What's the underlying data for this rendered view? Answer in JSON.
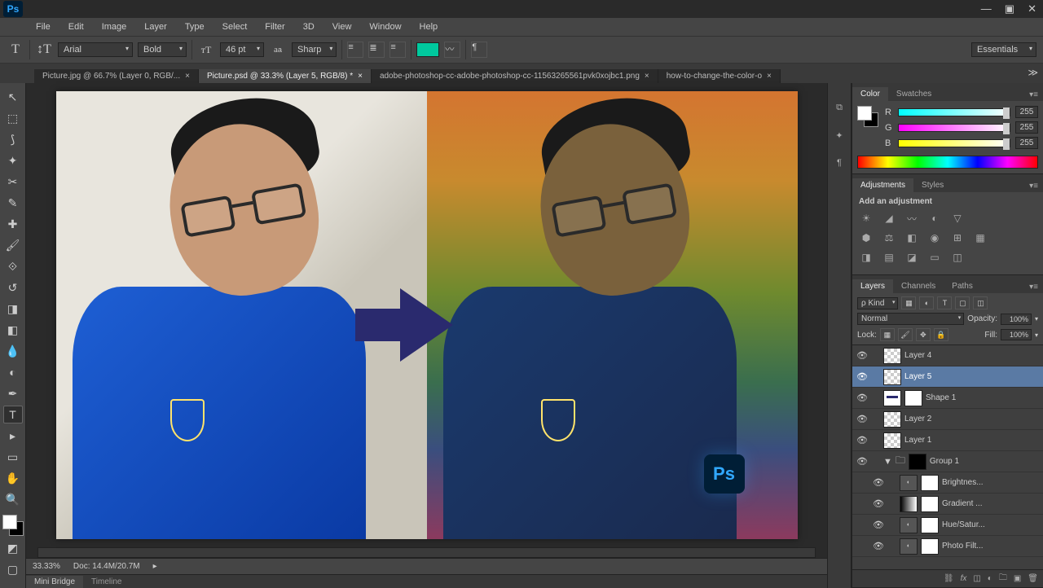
{
  "app": {
    "logo_text": "Ps"
  },
  "menu": [
    "File",
    "Edit",
    "Image",
    "Layer",
    "Type",
    "Select",
    "Filter",
    "3D",
    "View",
    "Window",
    "Help"
  ],
  "workspace": {
    "preset": "Essentials"
  },
  "options": {
    "font_family": "Arial",
    "font_style": "Bold",
    "font_size": "46 pt",
    "antialias": "Sharp",
    "text_color": "#00c99e"
  },
  "tabs": [
    {
      "label": "Picture.jpg @ 66.7% (Layer 0, RGB/..."
    },
    {
      "label": "Picture.psd @ 33.3% (Layer 5, RGB/8) *",
      "active": true
    },
    {
      "label": "adobe-photoshop-cc-adobe-photoshop-cc-11563265561pvk0xojbc1.png"
    },
    {
      "label": "how-to-change-the-color-o"
    }
  ],
  "color": {
    "fg": "#ffffff",
    "bg": "#000000",
    "r": "255",
    "g": "255",
    "b": "255"
  },
  "panels": {
    "color_tabs": [
      "Color",
      "Swatches"
    ],
    "adjustments_tabs": [
      "Adjustments",
      "Styles"
    ],
    "adjustments_title": "Add an adjustment",
    "layers_tabs": [
      "Layers",
      "Channels",
      "Paths"
    ]
  },
  "layers_panel": {
    "filter_kind": "Kind",
    "blend_mode": "Normal",
    "opacity_label": "Opacity:",
    "opacity": "100%",
    "lock_label": "Lock:",
    "fill_label": "Fill:",
    "fill": "100%"
  },
  "layers": [
    {
      "name": "Layer 4",
      "thumb": "checker"
    },
    {
      "name": "Layer 5",
      "thumb": "checker",
      "active": true
    },
    {
      "name": "Shape 1",
      "thumb": "shape",
      "mask": true
    },
    {
      "name": "Layer 2",
      "thumb": "checker"
    },
    {
      "name": "Layer 1",
      "thumb": "checker"
    },
    {
      "name": "Group 1",
      "type": "group",
      "mask_black": true
    },
    {
      "name": "Brightnes...",
      "adjust": true,
      "nested": true
    },
    {
      "name": "Gradient ...",
      "adjust_grad": true,
      "nested": true
    },
    {
      "name": "Hue/Satur...",
      "adjust": true,
      "nested": true
    },
    {
      "name": "Photo Filt...",
      "adjust": true,
      "nested": true
    }
  ],
  "status": {
    "zoom": "33.33%",
    "doc": "Doc: 14.4M/20.7M"
  },
  "bottom_tabs": [
    "Mini Bridge",
    "Timeline"
  ],
  "splash": {
    "text": "Ps"
  }
}
